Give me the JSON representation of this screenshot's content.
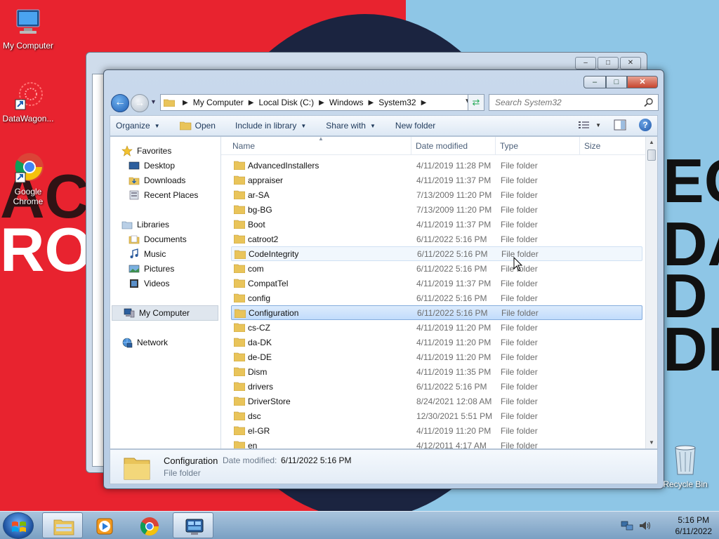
{
  "desktop": {
    "icons": [
      {
        "label": "My Computer"
      },
      {
        "label": "DataWagon..."
      },
      {
        "label": "Google Chrome"
      },
      {
        "label": "Recycle Bin"
      }
    ],
    "wallpaper_text": {
      "left_top": "AC",
      "left_bottom": "ROT",
      "right_1": "EC",
      "right_2": "DA",
      "right_3": "D",
      "right_4": "DE"
    }
  },
  "window": {
    "back_window_buttons": [
      "–",
      "□",
      "✕"
    ],
    "buttons": {
      "minimize": "–",
      "maximize": "□",
      "close": "✕"
    },
    "address": {
      "crumbs": [
        "My Computer",
        "Local Disk (C:)",
        "Windows",
        "System32"
      ]
    },
    "search": {
      "placeholder": "Search System32"
    },
    "toolbar": {
      "organize": "Organize",
      "open": "Open",
      "include_library": "Include in library",
      "share_with": "Share with",
      "new_folder": "New folder"
    },
    "navpane": {
      "favorites": "Favorites",
      "desktop": "Desktop",
      "downloads": "Downloads",
      "recent": "Recent Places",
      "libraries": "Libraries",
      "documents": "Documents",
      "music": "Music",
      "pictures": "Pictures",
      "videos": "Videos",
      "my_computer": "My Computer",
      "network": "Network"
    },
    "columns": {
      "name": "Name",
      "date": "Date modified",
      "type": "Type",
      "size": "Size"
    },
    "files": [
      {
        "name": "AdvancedInstallers",
        "date": "4/11/2019 11:28 PM",
        "type": "File folder"
      },
      {
        "name": "appraiser",
        "date": "4/11/2019 11:37 PM",
        "type": "File folder"
      },
      {
        "name": "ar-SA",
        "date": "7/13/2009 11:20 PM",
        "type": "File folder"
      },
      {
        "name": "bg-BG",
        "date": "7/13/2009 11:20 PM",
        "type": "File folder"
      },
      {
        "name": "Boot",
        "date": "4/11/2019 11:37 PM",
        "type": "File folder"
      },
      {
        "name": "catroot2",
        "date": "6/11/2022 5:16 PM",
        "type": "File folder"
      },
      {
        "name": "CodeIntegrity",
        "date": "6/11/2022 5:16 PM",
        "type": "File folder"
      },
      {
        "name": "com",
        "date": "6/11/2022 5:16 PM",
        "type": "File folder"
      },
      {
        "name": "CompatTel",
        "date": "4/11/2019 11:37 PM",
        "type": "File folder"
      },
      {
        "name": "config",
        "date": "6/11/2022 5:16 PM",
        "type": "File folder"
      },
      {
        "name": "Configuration",
        "date": "6/11/2022 5:16 PM",
        "type": "File folder"
      },
      {
        "name": "cs-CZ",
        "date": "4/11/2019 11:20 PM",
        "type": "File folder"
      },
      {
        "name": "da-DK",
        "date": "4/11/2019 11:20 PM",
        "type": "File folder"
      },
      {
        "name": "de-DE",
        "date": "4/11/2019 11:20 PM",
        "type": "File folder"
      },
      {
        "name": "Dism",
        "date": "4/11/2019 11:35 PM",
        "type": "File folder"
      },
      {
        "name": "drivers",
        "date": "6/11/2022 5:16 PM",
        "type": "File folder"
      },
      {
        "name": "DriverStore",
        "date": "8/24/2021 12:08 AM",
        "type": "File folder"
      },
      {
        "name": "dsc",
        "date": "12/30/2021 5:51 PM",
        "type": "File folder"
      },
      {
        "name": "el-GR",
        "date": "4/11/2019 11:20 PM",
        "type": "File folder"
      },
      {
        "name": "en",
        "date": "4/12/2011 4:17 AM",
        "type": "File folder"
      }
    ],
    "details": {
      "name": "Configuration",
      "date_label": "Date modified:",
      "date_value": "6/11/2022 5:16 PM",
      "type": "File folder"
    }
  },
  "taskbar": {
    "clock_time": "5:16 PM",
    "clock_date": "6/11/2022"
  },
  "colors": {
    "selection": "#c1dcfc",
    "wallpaper_red": "#e8232f",
    "wallpaper_blue": "#8ec6e6"
  }
}
